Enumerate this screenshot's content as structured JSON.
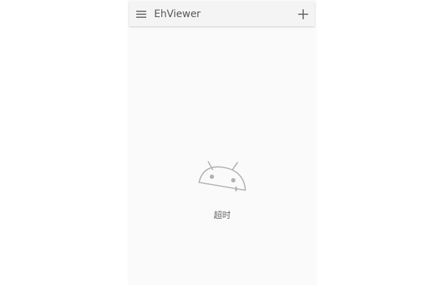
{
  "app_title": "EhViewer",
  "toolbar": {
    "menu_icon": "menu-icon",
    "add_icon": "plus-icon"
  },
  "empty_state": {
    "icon": "sad-android-icon",
    "message": "超时"
  },
  "colors": {
    "background": "#fafafa",
    "toolbar": "#f4f4f4",
    "icon": "#666666",
    "illustration": "#b0b0b0"
  }
}
